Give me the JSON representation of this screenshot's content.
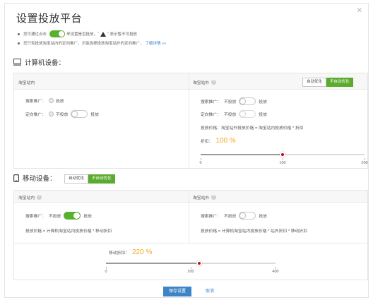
{
  "dialog": {
    "title": "设置投放平台",
    "close_icon": "close-icon"
  },
  "tips": {
    "tip1_prefix": "您可通过点击",
    "tip1_mid": "来设置是否投放，",
    "tip1_warn_text": "\" 表示暂不可投放",
    "tip1_quote": "\"",
    "tip2_text": "您只有投放淘宝站内的定向推广，才能选择投放淘宝站外的定向推广，",
    "tip2_link": "了解详情 »»"
  },
  "computer": {
    "heading": "计算机设备：",
    "icon": "monitor-icon",
    "inside": {
      "title": "淘宝站内",
      "search_label": "搜索推广：",
      "search_value": "投放",
      "targeted_label": "定向推广：",
      "targeted_off": "不投放",
      "targeted_on": "投放"
    },
    "outside": {
      "title": "淘宝站外",
      "btn_auto": "自动优化",
      "btn_noauto": "不自动优化",
      "search_label": "搜索推广：",
      "search_off": "不投放",
      "search_on": "投放",
      "targeted_label": "定向推广：",
      "targeted_off": "不投放",
      "targeted_on": "投放",
      "price_formula": "投放价格：淘宝站外投放价格 = 淘宝站内投放价格 * 折扣",
      "discount_label": "折扣：",
      "discount_value": "100 %",
      "slider_value": 100,
      "slider_max": 200,
      "ticks": [
        "0",
        "100",
        "200"
      ]
    }
  },
  "mobile": {
    "heading": "移动设备：",
    "icon": "mobile-phone-icon",
    "btn_auto": "自动优化",
    "btn_noauto": "不自动优化",
    "inside": {
      "title": "淘宝站内",
      "search_label": "搜索推广：",
      "search_off": "不投放",
      "search_on": "投放",
      "price_formula": "投放价格 = 计算机淘宝站内投放价格 * 移动折扣"
    },
    "outside": {
      "title": "淘宝站外",
      "search_label": "搜索推广：",
      "search_off": "不投放",
      "search_on": "投放",
      "price_formula": "投放价格 = 计算机淘宝站内投放价格 * 站外折扣 * 移动折扣"
    },
    "discount_label": "移动折扣：",
    "discount_value": "220 %",
    "slider_value": 220,
    "slider_max": 400,
    "ticks": [
      "0",
      "200",
      "400"
    ]
  },
  "footer": {
    "save": "保存设置",
    "cancel": "取消"
  },
  "colors": {
    "accent_green": "#57b12f",
    "discount_orange": "#f5a623",
    "link_blue": "#3d7ed4",
    "thumb_red": "#d0021b"
  }
}
